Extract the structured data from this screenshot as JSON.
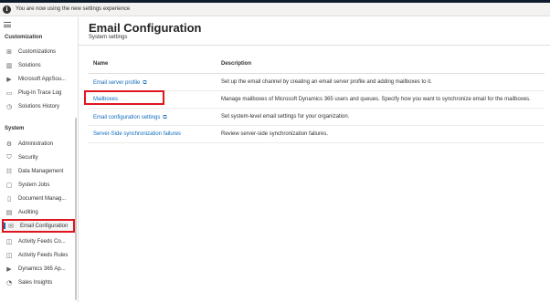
{
  "banner": {
    "text": "You are now using the new settings experience",
    "icon": "info-icon"
  },
  "sidebar": {
    "sections": [
      {
        "title": "Customization",
        "items": [
          {
            "label": "Customizations",
            "icon": "customizations-icon"
          },
          {
            "label": "Solutions",
            "icon": "solutions-icon"
          },
          {
            "label": "Microsoft AppSou...",
            "icon": "appsource-icon"
          },
          {
            "label": "Plug-In Trace Log",
            "icon": "trace-log-icon"
          },
          {
            "label": "Solutions History",
            "icon": "history-icon"
          }
        ]
      },
      {
        "title": "System",
        "items": [
          {
            "label": "Administration",
            "icon": "administration-icon"
          },
          {
            "label": "Security",
            "icon": "security-icon"
          },
          {
            "label": "Data Management",
            "icon": "data-management-icon"
          },
          {
            "label": "System Jobs",
            "icon": "system-jobs-icon"
          },
          {
            "label": "Document Manag...",
            "icon": "document-management-icon"
          },
          {
            "label": "Auditing",
            "icon": "auditing-icon"
          },
          {
            "label": "Email Configuration",
            "icon": "email-icon",
            "selected": true
          },
          {
            "label": "Activity Feeds Co...",
            "icon": "activity-feeds-icon"
          },
          {
            "label": "Activity Feeds Rules",
            "icon": "activity-rules-icon"
          },
          {
            "label": "Dynamics 365 Ap...",
            "icon": "dynamics-apps-icon"
          },
          {
            "label": "Sales Insights",
            "icon": "sales-insights-icon"
          }
        ]
      }
    ]
  },
  "main": {
    "title": "Email Configuration",
    "subtitle": "System settings",
    "table": {
      "headers": {
        "name": "Name",
        "description": "Description"
      },
      "rows": [
        {
          "name": "Email server profile",
          "external": true,
          "description": "Set up the email channel by creating an email server profile and adding mailboxes to it."
        },
        {
          "name": "Mailboxes",
          "external": false,
          "highlighted": true,
          "description": "Manage mailboxes of Microsoft Dynamics 365 users and queues. Specify how you want to synchronize email for the mailboxes."
        },
        {
          "name": "Email configuration settings",
          "external": true,
          "description": "Set system-level email settings for your organization."
        },
        {
          "name": "Server-Side synchronization failures",
          "external": false,
          "description": "Review server-side synchronization failures."
        }
      ]
    }
  },
  "colors": {
    "accent": "#0f6cbd",
    "highlight": "#e0161e",
    "topbar": "#0f1b2d"
  }
}
